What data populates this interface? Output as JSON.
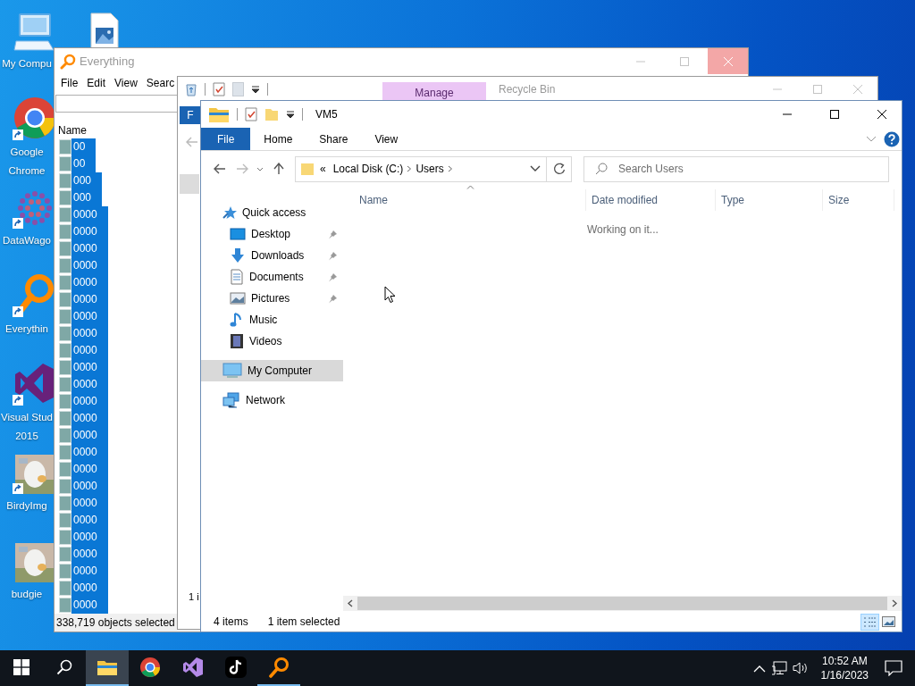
{
  "desktop": {
    "icons": [
      {
        "kind": "computer",
        "lines": [
          "My Compu"
        ],
        "shortcut": false
      },
      {
        "kind": "browser",
        "lines": [
          "Google",
          "Chrome"
        ],
        "shortcut": true
      },
      {
        "kind": "dots",
        "lines": [
          "DataWago"
        ],
        "shortcut": true
      },
      {
        "kind": "magnifier",
        "lines": [
          "Everythin"
        ],
        "shortcut": true
      },
      {
        "kind": "bowtie",
        "lines": [
          "Visual Stud",
          "2015"
        ],
        "shortcut": true
      },
      {
        "kind": "picture",
        "lines": [
          "BirdyImg"
        ],
        "shortcut": true
      },
      {
        "kind": "picture",
        "lines": [
          "budgie"
        ],
        "shortcut": false
      },
      {
        "kind": "image_file",
        "shortcut": false
      }
    ]
  },
  "everything": {
    "title": "Everything",
    "menu": [
      "File",
      "Edit",
      "View",
      "Searc"
    ],
    "column": "Name",
    "rows": [
      {
        "name": "00",
        "selected": true
      },
      {
        "name": "00",
        "selected": true
      },
      {
        "name": "000",
        "selected": true
      },
      {
        "name": "000",
        "selected": true
      },
      {
        "name": "0000",
        "selected": true
      },
      {
        "name": "0000",
        "selected": true
      },
      {
        "name": "0000",
        "selected": true
      },
      {
        "name": "0000",
        "selected": true
      },
      {
        "name": "0000",
        "selected": true
      },
      {
        "name": "0000",
        "selected": true
      },
      {
        "name": "0000",
        "selected": true
      },
      {
        "name": "0000",
        "selected": true
      },
      {
        "name": "0000",
        "selected": true
      },
      {
        "name": "0000",
        "selected": true
      },
      {
        "name": "0000",
        "selected": true
      },
      {
        "name": "0000",
        "selected": true
      },
      {
        "name": "0000",
        "selected": true
      },
      {
        "name": "0000",
        "selected": true
      },
      {
        "name": "0000",
        "selected": true
      },
      {
        "name": "0000",
        "selected": true
      },
      {
        "name": "0000",
        "selected": true
      },
      {
        "name": "0000",
        "selected": true
      },
      {
        "name": "0000",
        "selected": true
      },
      {
        "name": "0000",
        "selected": true
      },
      {
        "name": "0000",
        "selected": true
      },
      {
        "name": "0000",
        "selected": true
      },
      {
        "name": "0000",
        "selected": true
      },
      {
        "name": "0000",
        "selected": true
      }
    ],
    "status": "338,719 objects selected"
  },
  "recycle_bin": {
    "context_tab": "Manage",
    "title": "Recycle Bin",
    "file_tab": "F",
    "status": "1 i"
  },
  "explorer": {
    "title": "VM5",
    "tabs": [
      {
        "label": "File",
        "selected": true
      },
      {
        "label": "Home",
        "selected": false
      },
      {
        "label": "Share",
        "selected": false
      },
      {
        "label": "View",
        "selected": false
      }
    ],
    "address": {
      "overflow": "«",
      "parts": [
        "Local Disk (C:)",
        "Users"
      ]
    },
    "search": {
      "placeholder": "Search Users"
    },
    "nav": [
      {
        "label": "Quick access",
        "kind": "star",
        "selected": false,
        "children": [
          {
            "label": "Desktop",
            "kind": "desktop",
            "pinned": true,
            "selected": false
          },
          {
            "label": "Downloads",
            "kind": "downloads",
            "pinned": true,
            "selected": false
          },
          {
            "label": "Documents",
            "kind": "documents",
            "pinned": true,
            "selected": false
          },
          {
            "label": "Pictures",
            "kind": "pictures",
            "pinned": true,
            "selected": false
          },
          {
            "label": "Music",
            "kind": "music",
            "pinned": false,
            "selected": false
          },
          {
            "label": "Videos",
            "kind": "videos",
            "pinned": false,
            "selected": false
          }
        ]
      },
      {
        "label": "My Computer",
        "kind": "computer",
        "selected": true
      },
      {
        "label": "Network",
        "kind": "network",
        "selected": false
      }
    ],
    "columns": [
      {
        "label": "Name",
        "sorted": true
      },
      {
        "label": "Date modified",
        "sorted": false
      },
      {
        "label": "Type",
        "sorted": false
      },
      {
        "label": "Size",
        "sorted": false
      }
    ],
    "message": "Working on it...",
    "status": {
      "count": "4 items",
      "selection": "1 item selected"
    },
    "views": [
      {
        "kind": "details",
        "selected": true
      },
      {
        "kind": "thumbnails",
        "selected": false
      }
    ]
  },
  "taskbar": {
    "apps": [
      {
        "kind": "folder",
        "active": true,
        "running": true
      },
      {
        "kind": "browser",
        "active": false,
        "running": false
      },
      {
        "kind": "bowtie",
        "active": false,
        "running": false
      },
      {
        "kind": "note",
        "active": false,
        "running": false
      },
      {
        "kind": "magnifier",
        "active": false,
        "running": true
      }
    ],
    "time": "10:52 AM",
    "date": "1/16/2023"
  }
}
